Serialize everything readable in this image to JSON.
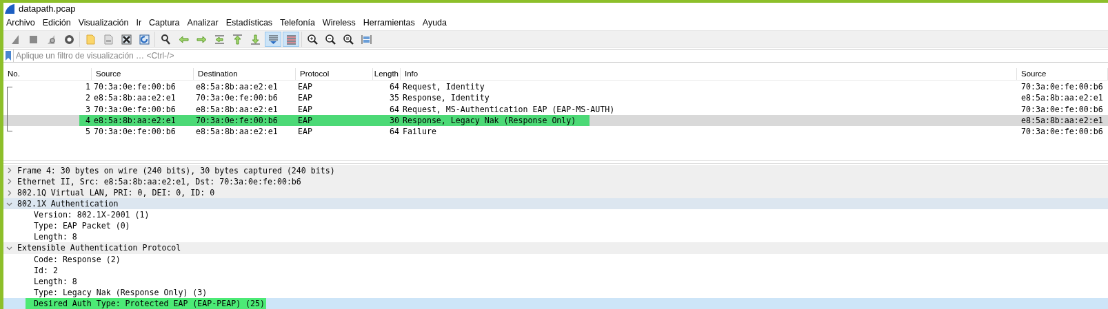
{
  "window": {
    "title": "datapath.pcap"
  },
  "menu": [
    "Archivo",
    "Edición",
    "Visualización",
    "Ir",
    "Captura",
    "Analizar",
    "Estadísticas",
    "Telefonía",
    "Wireless",
    "Herramientas",
    "Ayuda"
  ],
  "toolbar": [
    [
      {
        "pressed": false
      },
      {
        "pressed": false
      },
      {
        "pressed": false
      },
      {
        "pressed": false
      }
    ],
    [
      {
        "pressed": false
      },
      {
        "pressed": false
      },
      {
        "pressed": false
      },
      {
        "pressed": false
      }
    ],
    [
      {
        "pressed": false
      },
      {
        "pressed": false
      },
      {
        "pressed": false
      },
      {
        "pressed": false
      },
      {
        "pressed": false
      },
      {
        "pressed": false
      },
      {
        "pressed": true
      },
      {
        "pressed": true
      }
    ],
    [
      {
        "pressed": false
      },
      {
        "pressed": false
      },
      {
        "pressed": false
      },
      {
        "pressed": false
      }
    ]
  ],
  "filter": {
    "placeholder": "Aplique un filtro de visualización … <Ctrl-/>"
  },
  "packet_list": {
    "columns": [
      "No.",
      "Source",
      "Destination",
      "Protocol",
      "Length",
      "Info",
      "Source"
    ],
    "rows": [
      {
        "cells": [
          "1",
          "70:3a:0e:fe:00:b6",
          "e8:5a:8b:aa:e2:e1",
          "EAP",
          "64",
          "Request, Identity",
          "70:3a:0e:fe:00:b6"
        ],
        "selected": false,
        "highlighted": false
      },
      {
        "cells": [
          "2",
          "e8:5a:8b:aa:e2:e1",
          "70:3a:0e:fe:00:b6",
          "EAP",
          "35",
          "Response, Identity",
          "e8:5a:8b:aa:e2:e1"
        ],
        "selected": false,
        "highlighted": false
      },
      {
        "cells": [
          "3",
          "70:3a:0e:fe:00:b6",
          "e8:5a:8b:aa:e2:e1",
          "EAP",
          "64",
          "Request, MS-Authentication EAP (EAP-MS-AUTH)",
          "70:3a:0e:fe:00:b6"
        ],
        "selected": false,
        "highlighted": false
      },
      {
        "cells": [
          "4",
          "e8:5a:8b:aa:e2:e1",
          "70:3a:0e:fe:00:b6",
          "EAP",
          "30",
          "Response, Legacy Nak (Response Only)",
          "e8:5a:8b:aa:e2:e1"
        ],
        "selected": true,
        "highlighted": true
      },
      {
        "cells": [
          "5",
          "70:3a:0e:fe:00:b6",
          "e8:5a:8b:aa:e2:e1",
          "EAP",
          "64",
          "Failure",
          "70:3a:0e:fe:00:b6"
        ],
        "selected": false,
        "highlighted": false
      }
    ]
  },
  "details": [
    {
      "text": "Frame 4: 30 bytes on wire (240 bits), 30 bytes captured (240 bits)",
      "expanded": false,
      "hovered": false
    },
    {
      "text": "Ethernet II, Src: e8:5a:8b:aa:e2:e1, Dst: 70:3a:0e:fe:00:b6",
      "expanded": false,
      "hovered": false
    },
    {
      "text": "802.1Q Virtual LAN, PRI: 0, DEI: 0, ID: 0",
      "expanded": false,
      "hovered": false
    },
    {
      "text": "802.1X Authentication",
      "expanded": true,
      "hovered": true,
      "children": [
        {
          "text": "Version: 802.1X-2001 (1)",
          "selected": false,
          "highlighted": false
        },
        {
          "text": "Type: EAP Packet (0)",
          "selected": false,
          "highlighted": false
        },
        {
          "text": "Length: 8",
          "selected": false,
          "highlighted": false
        }
      ]
    },
    {
      "text": "Extensible Authentication Protocol",
      "expanded": true,
      "hovered": false,
      "children": [
        {
          "text": "Code: Response (2)",
          "selected": false,
          "highlighted": false
        },
        {
          "text": "Id: 2",
          "selected": false,
          "highlighted": false
        },
        {
          "text": "Length: 8",
          "selected": false,
          "highlighted": false
        },
        {
          "text": "Type: Legacy Nak (Response Only) (3)",
          "selected": false,
          "highlighted": false
        },
        {
          "text": "Desired Auth Type: Protected EAP (EAP-PEAP) (25)",
          "selected": true,
          "highlighted": true
        }
      ]
    }
  ]
}
